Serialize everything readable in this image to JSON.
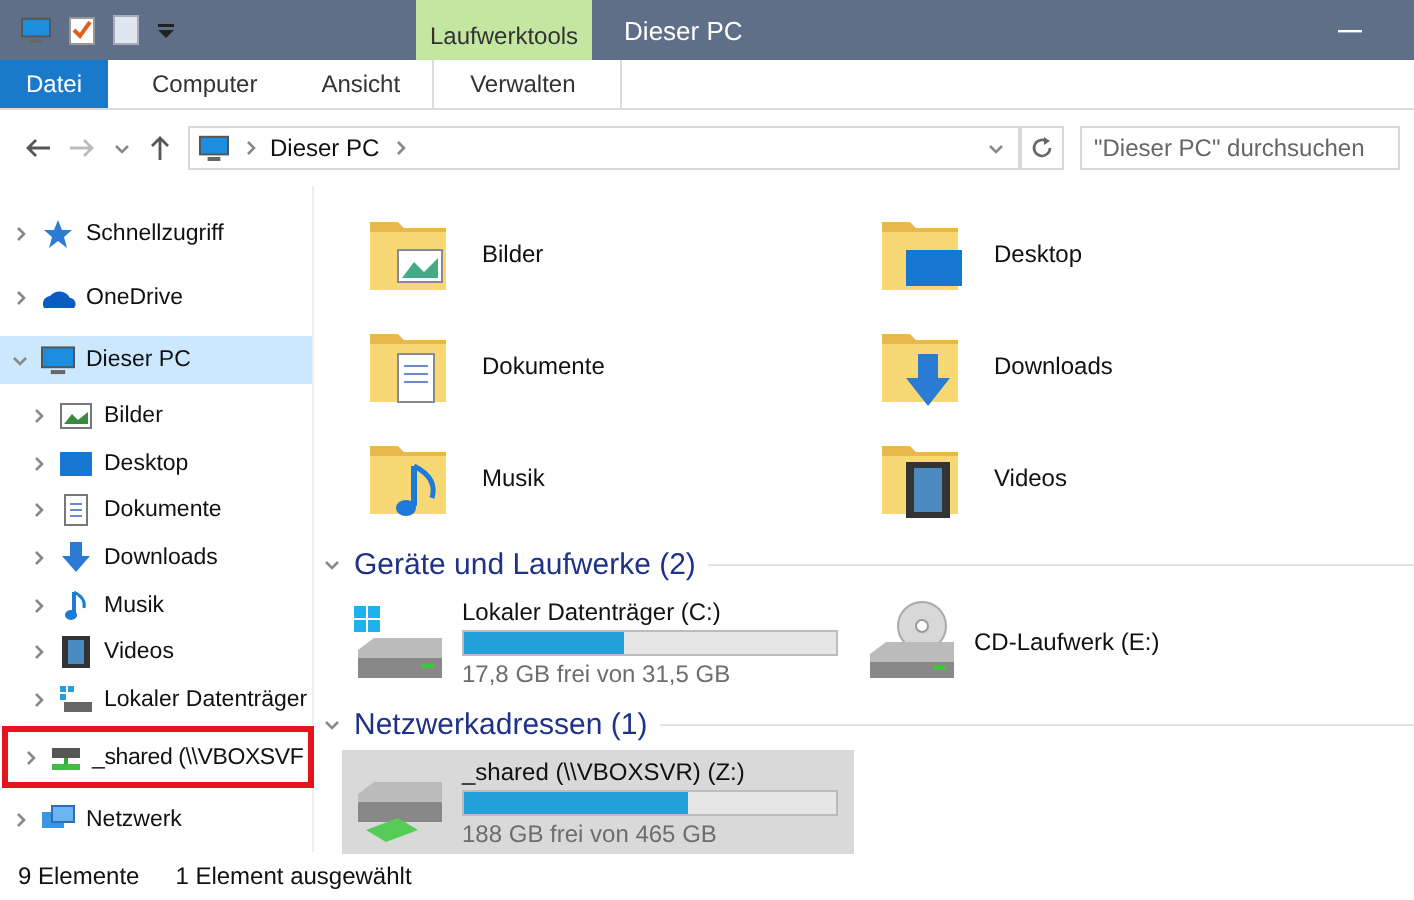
{
  "window": {
    "title": "Dieser PC",
    "context_tab": "Laufwerktools"
  },
  "ribbon_tabs": [
    {
      "label": "Datei",
      "selected": true,
      "kind": "file"
    },
    {
      "label": "Computer",
      "selected": false,
      "kind": "tab"
    },
    {
      "label": "Ansicht",
      "selected": false,
      "kind": "tab"
    },
    {
      "label": "Verwalten",
      "selected": false,
      "kind": "context"
    }
  ],
  "address": {
    "crumbs": [
      "Dieser PC"
    ]
  },
  "search": {
    "placeholder": "\"Dieser PC\" durchsuchen"
  },
  "sidebar": {
    "items": [
      {
        "label": "Schnellzugriff",
        "selected": false,
        "expanded": false,
        "highlighted": false
      },
      {
        "label": "OneDrive",
        "selected": false,
        "expanded": false,
        "highlighted": false
      },
      {
        "label": "Dieser PC",
        "selected": true,
        "expanded": true,
        "highlighted": false,
        "children": [
          {
            "label": "Bilder",
            "selected": false,
            "expanded": false,
            "highlighted": false
          },
          {
            "label": "Desktop",
            "selected": false,
            "expanded": false,
            "highlighted": false
          },
          {
            "label": "Dokumente",
            "selected": false,
            "expanded": false,
            "highlighted": false
          },
          {
            "label": "Downloads",
            "selected": false,
            "expanded": false,
            "highlighted": false
          },
          {
            "label": "Musik",
            "selected": false,
            "expanded": false,
            "highlighted": false
          },
          {
            "label": "Videos",
            "selected": false,
            "expanded": false,
            "highlighted": false
          },
          {
            "label": "Lokaler Datenträger",
            "selected": false,
            "expanded": false,
            "highlighted": false
          },
          {
            "label": "_shared (\\\\VBOXSVF",
            "selected": false,
            "expanded": false,
            "highlighted": true
          }
        ]
      },
      {
        "label": "Netzwerk",
        "selected": false,
        "expanded": false,
        "highlighted": false
      }
    ]
  },
  "folders": [
    {
      "label": "Bilder",
      "selected": false
    },
    {
      "label": "Desktop",
      "selected": false
    },
    {
      "label": "Dokumente",
      "selected": false
    },
    {
      "label": "Downloads",
      "selected": false
    },
    {
      "label": "Musik",
      "selected": false
    },
    {
      "label": "Videos",
      "selected": false
    }
  ],
  "sections": [
    {
      "title": "Geräte und Laufwerke (2)",
      "expanded": true,
      "drives": [
        {
          "kind": "disk",
          "name": "Lokaler Datenträger (C:)",
          "level": 0.43,
          "free": "17,8 GB frei von 31,5 GB",
          "selected": false
        },
        {
          "kind": "cd",
          "name": "CD-Laufwerk (E:)",
          "selected": false
        }
      ]
    },
    {
      "title": "Netzwerkadressen (1)",
      "expanded": true,
      "drives": [
        {
          "kind": "network",
          "name": "_shared (\\\\VBOXSVR) (Z:)",
          "level": 0.6,
          "free": "188 GB frei von 465 GB",
          "selected": true
        }
      ]
    }
  ],
  "status_bar": {
    "count": "9 Elemente",
    "selection": "1 Element ausgewählt"
  }
}
